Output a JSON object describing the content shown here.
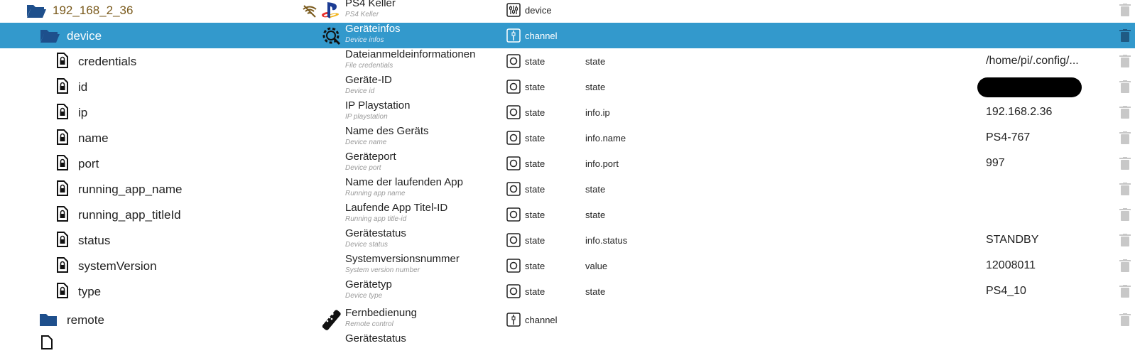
{
  "rows": [
    {
      "tree": "192_168_2_36",
      "name": "PS4 Keller",
      "sub": "PS4 Keller",
      "type": "device",
      "role": "",
      "value": ""
    },
    {
      "tree": "device",
      "name": "Geräteinfos",
      "sub": "Device infos",
      "type": "channel",
      "role": "",
      "value": ""
    },
    {
      "tree": "credentials",
      "name": "Dateianmeldeinformationen",
      "sub": "File credentials",
      "type": "state",
      "role": "state",
      "value": "/home/pi/.config/..."
    },
    {
      "tree": "id",
      "name": "Geräte-ID",
      "sub": "Device id",
      "type": "state",
      "role": "state",
      "value": ""
    },
    {
      "tree": "ip",
      "name": "IP Playstation",
      "sub": "IP playstation",
      "type": "state",
      "role": "info.ip",
      "value": "192.168.2.36"
    },
    {
      "tree": "name",
      "name": "Name des Geräts",
      "sub": "Device name",
      "type": "state",
      "role": "info.name",
      "value": "PS4-767"
    },
    {
      "tree": "port",
      "name": "Geräteport",
      "sub": "Device port",
      "type": "state",
      "role": "info.port",
      "value": "997"
    },
    {
      "tree": "running_app_name",
      "name": "Name der laufenden App",
      "sub": "Running app name",
      "type": "state",
      "role": "state",
      "value": ""
    },
    {
      "tree": "running_app_titleId",
      "name": "Laufende App Titel-ID",
      "sub": "Running app title-id",
      "type": "state",
      "role": "state",
      "value": ""
    },
    {
      "tree": "status",
      "name": "Gerätestatus",
      "sub": "Device status",
      "type": "state",
      "role": "info.status",
      "value": "STANDBY"
    },
    {
      "tree": "systemVersion",
      "name": "Systemversionsnummer",
      "sub": "System version number",
      "type": "state",
      "role": "value",
      "value": "12008011"
    },
    {
      "tree": "type",
      "name": "Gerätetyp",
      "sub": "Device type",
      "type": "state",
      "role": "state",
      "value": "PS4_10"
    },
    {
      "tree": "remote",
      "name": "Fernbedienung",
      "sub": "Remote control",
      "type": "channel",
      "role": "",
      "value": ""
    },
    {
      "tree": "",
      "name": "Gerätestatus",
      "sub": "",
      "type": "",
      "role": "",
      "value": ""
    }
  ],
  "colors": {
    "selected": "#3399cc",
    "folder": "#1e4f8c",
    "brown": "#7a5a1c",
    "trash": "#c8c8c8"
  },
  "icons": [
    "folder-open-icon",
    "folder-icon",
    "file-lock-icon",
    "wifi-off-icon",
    "playstation-logo-icon",
    "settings-gear-icon",
    "remote-control-icon",
    "device-type-icon",
    "channel-type-icon",
    "state-type-icon",
    "trash-icon"
  ]
}
